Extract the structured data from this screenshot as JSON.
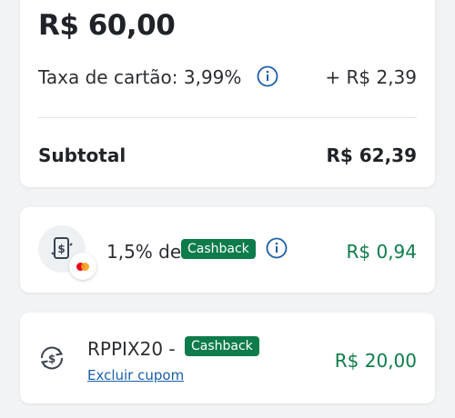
{
  "summary": {
    "total": "R$ 60,00",
    "fee_label": "Taxa de cartão: 3,99%",
    "fee_value": "+ R$ 2,39",
    "subtotal_label": "Subtotal",
    "subtotal_value": "R$ 62,39"
  },
  "cashback": {
    "text": "1,5% de",
    "badge": "Cashback",
    "value": "R$ 0,94",
    "icons": [
      "cashback-phone-icon",
      "mastercard-icon",
      "info-icon"
    ]
  },
  "coupon": {
    "code": "RPPIX20 -",
    "badge": "Cashback",
    "remove_link": "Excluir cupom",
    "value": "R$ 20,00",
    "icons": [
      "coupon-refresh-icon"
    ]
  },
  "colors": {
    "accent_green": "#0e7c4a",
    "link_blue": "#1a5fa8",
    "background": "#f1f3f5"
  }
}
